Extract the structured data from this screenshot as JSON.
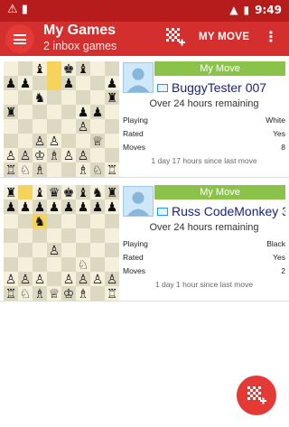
{
  "status_bar": {
    "time": "9:49"
  },
  "app_bar": {
    "title": "My Games",
    "subtitle": "2 inbox games",
    "my_move_label": "MY MOVE"
  },
  "games": [
    {
      "badge": "My Move",
      "opponent": "BuggyTester 007",
      "time_left": "Over 24 hours remaining",
      "playing_label": "Playing",
      "playing_value": "White",
      "rated_label": "Rated",
      "rated_value": "Yes",
      "moves_label": "Moves",
      "moves_value": "8",
      "last_move": "1 day 17 hours  since last move",
      "board": [
        "..b.kb..",
        "pp..p..p",
        "..n....r",
        "r....pp.",
        ".....P..",
        "..PP..Q.",
        "PPKBPP..",
        "RNB..BNR"
      ],
      "highlights": [
        [
          0,
          3
        ],
        [
          1,
          3
        ]
      ]
    },
    {
      "badge": "My Move",
      "opponent": "Russ CodeMonkey 3",
      "time_left": "Over 24 hours remaining",
      "playing_label": "Playing",
      "playing_value": "Black",
      "rated_label": "Rated",
      "rated_value": "Yes",
      "moves_label": "Moves",
      "moves_value": "2",
      "last_move": "1 day 1 hour  since last move",
      "board": [
        "r.bqkbnr",
        "pppppppp",
        "..n.....",
        "........",
        "...P....",
        ".....N..",
        "PPP.PPPP",
        "RNBQKB.R"
      ],
      "highlights": [
        [
          0,
          1
        ],
        [
          2,
          2
        ]
      ]
    }
  ]
}
